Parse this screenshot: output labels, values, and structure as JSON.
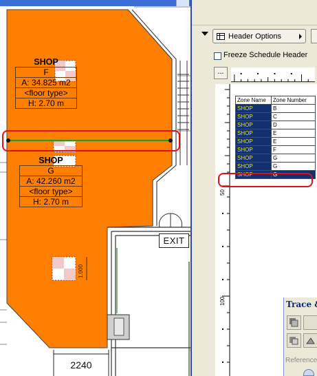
{
  "plan": {
    "zones": [
      {
        "name": "SHOP",
        "number": "F",
        "area": "A: 34.825 m2",
        "floor": "<floor type>",
        "height": "H: 2.70 m"
      },
      {
        "name": "SHOP",
        "number": "G",
        "area": "A: 42.260 m2",
        "floor": "<floor type>",
        "height": "H: 2.70 m"
      }
    ],
    "exit_sign": "EXIT",
    "dimension_bottom": "2240",
    "dimension_vertical": "1.000"
  },
  "panel": {
    "header_options_label": "Header Options",
    "freeze_label": "Freeze Schedule Header",
    "freeze_checked": false,
    "ellipsis_label": "...",
    "ruler_labels": [
      "50",
      "100"
    ],
    "table": {
      "headers": [
        "Zone Name",
        "Zone Number"
      ],
      "rows": [
        {
          "name": "SHOP",
          "number": "B"
        },
        {
          "name": "SHOP",
          "number": "C"
        },
        {
          "name": "SHOP",
          "number": "D"
        },
        {
          "name": "SHOP",
          "number": "E"
        },
        {
          "name": "SHOP",
          "number": "E"
        },
        {
          "name": "SHOP",
          "number": "F"
        },
        {
          "name": "SHOP",
          "number": "G"
        },
        {
          "name": "SHOP",
          "number": "G"
        },
        {
          "name": "SHOP",
          "number": "G",
          "selected": true
        }
      ]
    }
  },
  "trace_palette": {
    "title": "Trace &",
    "reference_label": "Reference"
  },
  "colors": {
    "zone_fill": "#ff8000",
    "highlight": "#e01010",
    "selection": "#14306e",
    "zone_name_text": "#e8e800",
    "wall_line": "#55c43a"
  }
}
